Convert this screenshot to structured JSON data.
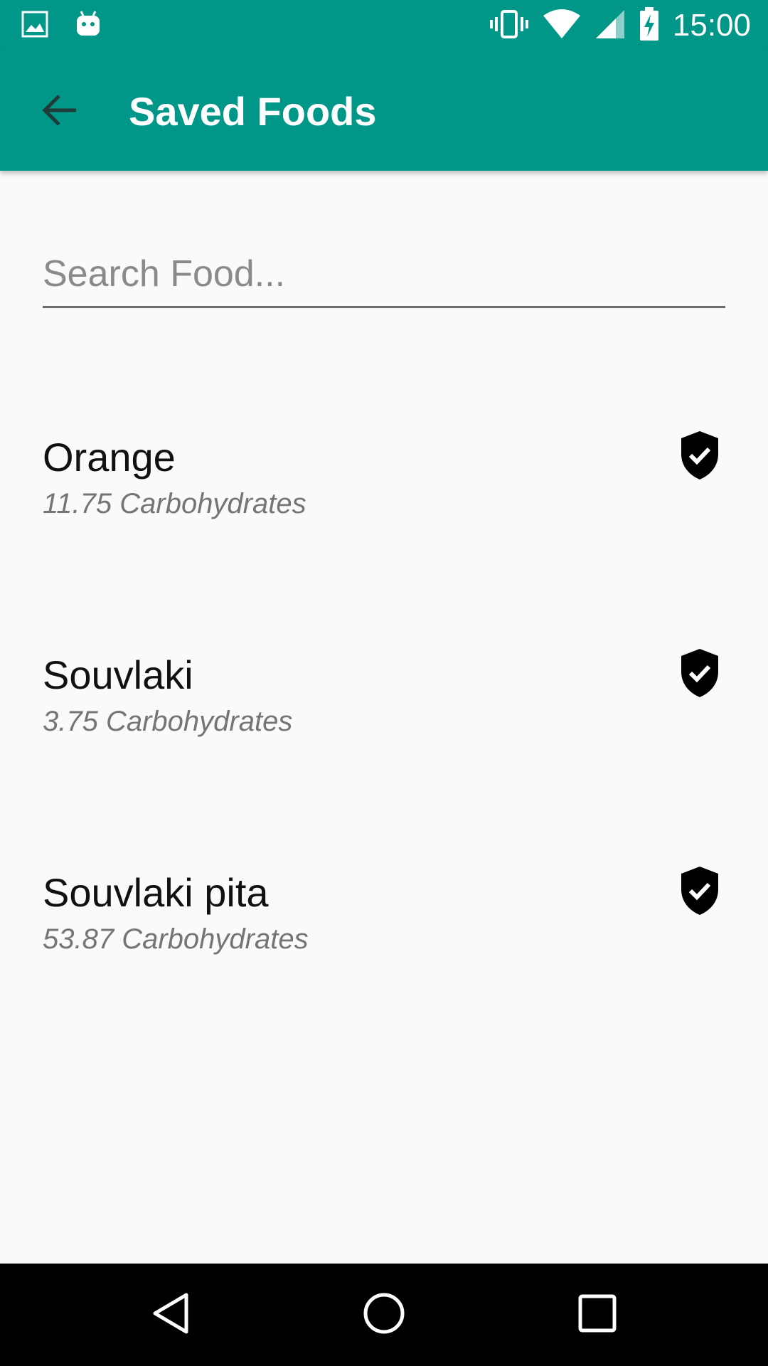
{
  "status_bar": {
    "time": "15:00",
    "left_icons": [
      "image-icon",
      "android-icon"
    ],
    "right_icons": [
      "vibrate-icon",
      "wifi-icon",
      "signal-icon",
      "battery-charging-icon"
    ]
  },
  "app_bar": {
    "title": "Saved Foods",
    "back_icon": "arrow-back-icon",
    "color": "#009688"
  },
  "search": {
    "placeholder": "Search Food...",
    "value": ""
  },
  "foods": [
    {
      "name": "Orange",
      "detail": "11.75 Carbohydrates",
      "icon": "verified-shield-icon"
    },
    {
      "name": "Souvlaki",
      "detail": "3.75 Carbohydrates",
      "icon": "verified-shield-icon"
    },
    {
      "name": "Souvlaki pita",
      "detail": "53.87 Carbohydrates",
      "icon": "verified-shield-icon"
    }
  ],
  "nav_bar": {
    "buttons": [
      "back-nav-icon",
      "home-nav-icon",
      "recents-nav-icon"
    ]
  }
}
